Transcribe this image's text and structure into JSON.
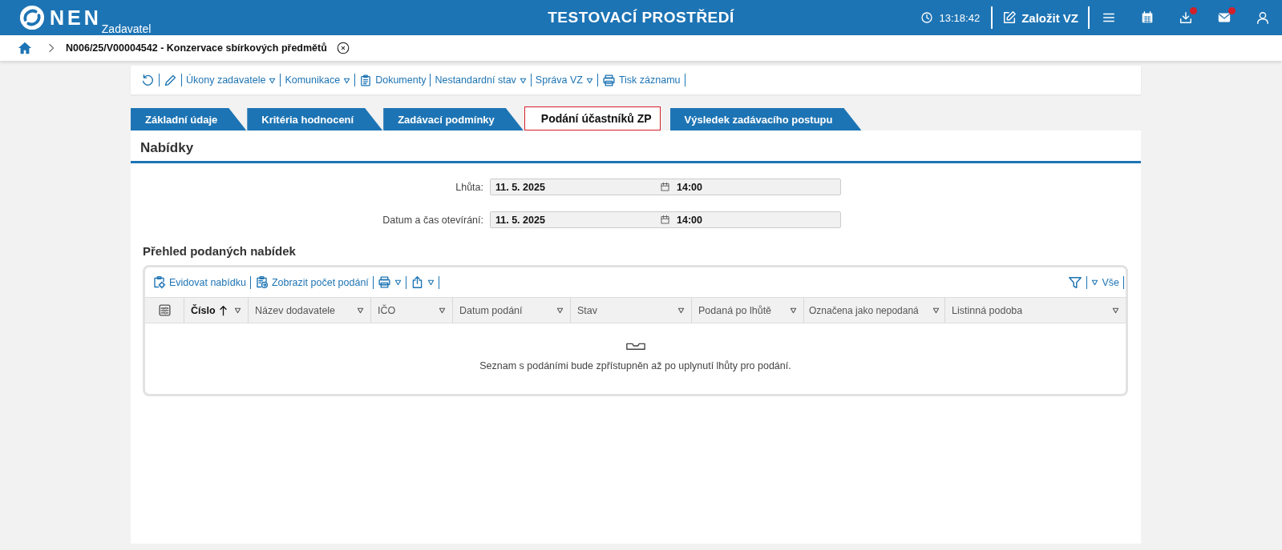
{
  "header": {
    "logo": "NEN",
    "logo_sub": "Zadavatel",
    "environment": "TESTOVACÍ PROSTŘEDÍ",
    "time": "13:18:42",
    "create_button": "Založit VZ",
    "icons": [
      {
        "kind": "menu",
        "badge": false
      },
      {
        "kind": "calendar",
        "badge": false
      },
      {
        "kind": "download",
        "badge": true
      },
      {
        "kind": "mail",
        "badge": true
      },
      {
        "kind": "user",
        "badge": false
      }
    ]
  },
  "breadcrumb": {
    "title": "N006/25/V00004542 - Konzervace sbírkových předmětů"
  },
  "toolbar": [
    {
      "kind": "refresh",
      "dropdown": false
    },
    {
      "kind": "pencil",
      "dropdown": false
    },
    {
      "kind": "text",
      "label": "Úkony zadavatele",
      "dropdown": true
    },
    {
      "kind": "text",
      "label": "Komunikace",
      "dropdown": true
    },
    {
      "kind": "clipboard",
      "label": "Dokumenty",
      "dropdown": false
    },
    {
      "kind": "text",
      "label": "Nestandardní stav",
      "dropdown": true
    },
    {
      "kind": "text",
      "label": "Správa VZ",
      "dropdown": true
    },
    {
      "kind": "printer",
      "label": "Tisk záznamu",
      "dropdown": false
    }
  ],
  "tabs": [
    {
      "label": "Základní údaje",
      "selected": false
    },
    {
      "label": "Kritéria hodnocení",
      "selected": false
    },
    {
      "label": "Zadávací podmínky",
      "selected": false
    },
    {
      "label": "Podání účastníků ZP",
      "selected": true
    },
    {
      "label": "Výsledek zadávacího postupu",
      "selected": false
    }
  ],
  "section_title": "Nabídky",
  "fields": [
    {
      "label": "Lhůta:",
      "date": "11. 5. 2025",
      "time": "14:00"
    },
    {
      "label": "Datum a čas otevírání:",
      "date": "11. 5. 2025",
      "time": "14:00"
    }
  ],
  "grid": {
    "title": "Přehled podaných nabídek",
    "actions": [
      {
        "kind": "clipboard-gear",
        "label": "Evidovat nabídku",
        "dropdown": false
      },
      {
        "kind": "clipboard-arrow",
        "label": "Zobrazit počet podání",
        "dropdown": false
      },
      {
        "kind": "printer",
        "dropdown": true
      },
      {
        "kind": "share",
        "dropdown": true
      }
    ],
    "filter_label": "Vše",
    "columns": [
      {
        "label": "Číslo",
        "sorted": true
      },
      {
        "label": "Název dodavatele",
        "sorted": false
      },
      {
        "label": "IČO",
        "sorted": false
      },
      {
        "label": "Datum podání",
        "sorted": false
      },
      {
        "label": "Stav",
        "sorted": false
      },
      {
        "label": "Podaná po lhůtě",
        "sorted": false
      },
      {
        "label": "Označena jako nepodaná",
        "sorted": false
      },
      {
        "label": "Listinná podoba",
        "sorted": false
      }
    ],
    "empty_message": "Seznam s podáními bude zpřístupněn až po uplynutí lhůty pro podání."
  }
}
